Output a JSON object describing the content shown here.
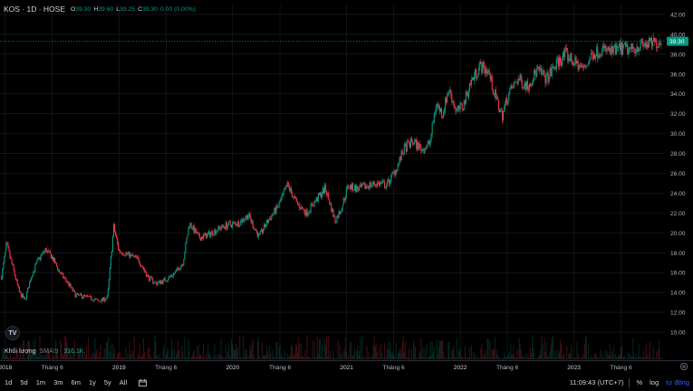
{
  "header": {
    "symbol": "KOS · 1D · HOSE",
    "open_key": "O",
    "open": "39.30",
    "high_key": "H",
    "high": "39.60",
    "low_key": "L",
    "low": "39.25",
    "close_key": "C",
    "close": "39.30",
    "change": "0.00 (0.00%)"
  },
  "volume_legend": {
    "label": "Khối lượng",
    "sma": "SMA 9",
    "value": "316.1K"
  },
  "bottom_bar": {
    "ranges": [
      "1d",
      "5d",
      "1m",
      "3m",
      "6m",
      "1y",
      "5y",
      "All"
    ],
    "clock": "11:09:43 (UTC+7)",
    "percent_label": "%",
    "log_label": "log",
    "auto_label": "tự động"
  },
  "logo_text": "TV",
  "colors": {
    "up": "#089981",
    "down": "#f23645",
    "grid": "#1c1f26",
    "price_line": "#089981",
    "background": "#000000"
  },
  "chart_data": {
    "type": "candlestick",
    "title": "",
    "price_axis": {
      "ticks": [
        10,
        12,
        14,
        16,
        18,
        20,
        22,
        24,
        26,
        28,
        30,
        32,
        34,
        36,
        38,
        40,
        42
      ],
      "tick_labels": [
        "10.00",
        "12.00",
        "14.00",
        "16.00",
        "18.00",
        "20.00",
        "22.00",
        "24.00",
        "26.00",
        "28.00",
        "30.00",
        "32.00",
        "34.00",
        "36.00",
        "38.00",
        "40.00",
        "42.00"
      ],
      "range": [
        9,
        43
      ],
      "current_price": 39.3,
      "current_price_label": "39.30"
    },
    "time_axis": {
      "labels": [
        {
          "label": "2018",
          "date": "2018-01-01"
        },
        {
          "label": "Tháng 6",
          "date": "2018-06-01"
        },
        {
          "label": "2019",
          "date": "2019-01-01"
        },
        {
          "label": "Tháng 6",
          "date": "2019-06-01"
        },
        {
          "label": "2020",
          "date": "2020-01-01"
        },
        {
          "label": "Tháng 6",
          "date": "2020-06-01"
        },
        {
          "label": "2021",
          "date": "2021-01-01"
        },
        {
          "label": "Tháng 6",
          "date": "2021-06-01"
        },
        {
          "label": "2022",
          "date": "2022-01-01"
        },
        {
          "label": "Tháng 6",
          "date": "2022-06-01"
        },
        {
          "label": "2023",
          "date": "2023-01-01"
        },
        {
          "label": "Tháng 6",
          "date": "2023-06-01"
        }
      ],
      "range": [
        "2017-12-15",
        "2023-10-20"
      ]
    },
    "path": [
      [
        "2017-12-20",
        15.6
      ],
      [
        "2018-01-05",
        18.9
      ],
      [
        "2018-01-25",
        16.5
      ],
      [
        "2018-02-15",
        14.0
      ],
      [
        "2018-03-05",
        13.2
      ],
      [
        "2018-03-25",
        15.6
      ],
      [
        "2018-04-15",
        17.2
      ],
      [
        "2018-05-10",
        18.3
      ],
      [
        "2018-05-30",
        17.6
      ],
      [
        "2018-06-25",
        16.0
      ],
      [
        "2018-07-20",
        15.0
      ],
      [
        "2018-08-15",
        13.7
      ],
      [
        "2018-09-10",
        13.6
      ],
      [
        "2018-10-05",
        13.4
      ],
      [
        "2018-10-30",
        13.1
      ],
      [
        "2018-11-25",
        13.5
      ],
      [
        "2018-12-15",
        20.6
      ],
      [
        "2019-01-01",
        18.2
      ],
      [
        "2019-02-01",
        17.8
      ],
      [
        "2019-03-05",
        17.3
      ],
      [
        "2019-04-05",
        15.5
      ],
      [
        "2019-05-01",
        14.9
      ],
      [
        "2019-06-01",
        15.3
      ],
      [
        "2019-07-01",
        16.0
      ],
      [
        "2019-07-25",
        17.0
      ],
      [
        "2019-08-15",
        21.0
      ],
      [
        "2019-09-15",
        19.5
      ],
      [
        "2019-10-15",
        19.8
      ],
      [
        "2019-11-15",
        20.4
      ],
      [
        "2019-12-15",
        20.8
      ],
      [
        "2020-01-20",
        21.0
      ],
      [
        "2020-02-20",
        21.8
      ],
      [
        "2020-03-25",
        19.6
      ],
      [
        "2020-04-25",
        21.3
      ],
      [
        "2020-05-25",
        22.6
      ],
      [
        "2020-06-25",
        24.8
      ],
      [
        "2020-07-25",
        23.0
      ],
      [
        "2020-08-25",
        22.0
      ],
      [
        "2020-09-25",
        23.3
      ],
      [
        "2020-10-25",
        24.5
      ],
      [
        "2020-11-25",
        21.2
      ],
      [
        "2020-12-15",
        22.5
      ],
      [
        "2021-01-05",
        24.7
      ],
      [
        "2021-02-10",
        24.4
      ],
      [
        "2021-03-10",
        24.8
      ],
      [
        "2021-04-10",
        25.0
      ],
      [
        "2021-05-10",
        24.8
      ],
      [
        "2021-06-10",
        26.5
      ],
      [
        "2021-07-05",
        28.5
      ],
      [
        "2021-08-01",
        29.2
      ],
      [
        "2021-09-01",
        28.4
      ],
      [
        "2021-09-25",
        29.0
      ],
      [
        "2021-10-15",
        33.0
      ],
      [
        "2021-11-05",
        32.0
      ],
      [
        "2021-11-25",
        34.5
      ],
      [
        "2021-12-20",
        32.2
      ],
      [
        "2022-01-10",
        32.8
      ],
      [
        "2022-02-01",
        35.0
      ],
      [
        "2022-03-05",
        36.8
      ],
      [
        "2022-04-01",
        36.3
      ],
      [
        "2022-04-20",
        34.0
      ],
      [
        "2022-05-15",
        31.8
      ],
      [
        "2022-06-05",
        34.0
      ],
      [
        "2022-07-05",
        35.5
      ],
      [
        "2022-08-05",
        34.8
      ],
      [
        "2022-09-05",
        36.4
      ],
      [
        "2022-10-05",
        35.5
      ],
      [
        "2022-11-05",
        37.0
      ],
      [
        "2022-12-05",
        38.0
      ],
      [
        "2023-01-01",
        37.2
      ],
      [
        "2023-02-01",
        36.5
      ],
      [
        "2023-03-01",
        38.0
      ],
      [
        "2023-04-01",
        38.5
      ],
      [
        "2023-05-01",
        38.2
      ],
      [
        "2023-06-01",
        38.6
      ],
      [
        "2023-07-01",
        38.4
      ],
      [
        "2023-08-01",
        38.9
      ],
      [
        "2023-09-01",
        39.0
      ],
      [
        "2023-10-10",
        39.3
      ]
    ]
  }
}
